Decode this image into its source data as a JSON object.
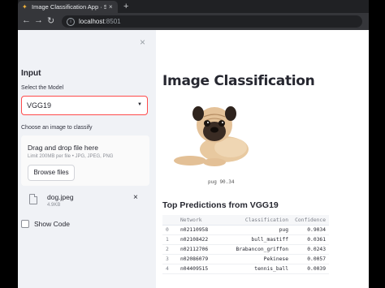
{
  "browser": {
    "tab_title": "Image Classification App · Strea",
    "url_host": "localhost",
    "url_port": ":8501",
    "back_icon": "←",
    "forward_icon": "→",
    "reload_icon": "↻",
    "new_tab_icon": "+",
    "tab_close_icon": "×"
  },
  "sidebar": {
    "close_icon": "×",
    "section_title": "Input",
    "model_label": "Select the Model",
    "model_value": "VGG19",
    "uploader_label": "Choose an image to classify",
    "dropzone_title": "Drag and drop file here",
    "dropzone_limit": "Limit 200MB per file • JPG, JPEG, PNG",
    "browse_button": "Browse files",
    "file_name": "dog.jpeg",
    "file_size": "4.9KB",
    "file_remove_icon": "×",
    "show_code_label": "Show Code",
    "show_code_checked": false
  },
  "main": {
    "title": "Image Classification",
    "image_caption": "pug 90.34",
    "section_title": "Top Predictions from VGG19",
    "table": {
      "headers": [
        "",
        "Network",
        "Classification",
        "Confidence"
      ],
      "rows": [
        [
          "0",
          "n02110958",
          "pug",
          "0.9034"
        ],
        [
          "1",
          "n02108422",
          "bull_mastiff",
          "0.0361"
        ],
        [
          "2",
          "n02112706",
          "Brabancon_griffon",
          "0.0243"
        ],
        [
          "3",
          "n02086079",
          "Pekinese",
          "0.0057"
        ],
        [
          "4",
          "n04409515",
          "tennis_ball",
          "0.0039"
        ]
      ]
    }
  },
  "colors": {
    "accent": "#ff4b4b",
    "sidebar_bg": "#f0f2f6",
    "text": "#262730"
  }
}
